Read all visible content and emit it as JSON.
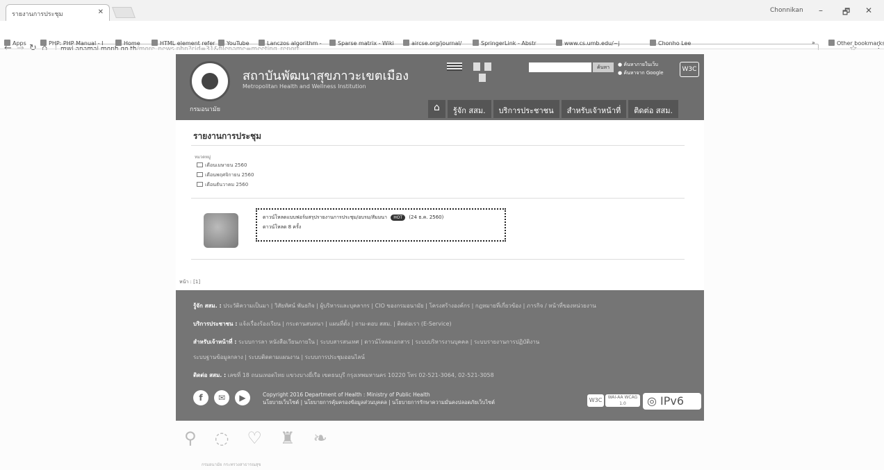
{
  "browser": {
    "tab_title": "รายงานการประชุม",
    "tab_close": "✕",
    "url_host": "mwi.anamai.moph.go.th",
    "url_path": "/more_news.php?cid=31&filename=meeting_report",
    "user_name": "Chonnikan",
    "win_min": "–",
    "win_max": "🗗",
    "win_close": "✕",
    "bookmarks": [
      "Apps",
      "PHP: PHP Manual - I",
      "Home",
      "HTML element refer",
      "YouTube",
      "Lanczos algorithm -",
      "Sparse matrix - Wiki",
      "aircse.org/journal/",
      "SpringerLink - Abstr",
      "www.cs.umb.edu/~j",
      "Chonho Lee"
    ],
    "other_bookmarks": "Other bookmarks",
    "more_bookmarks": "»"
  },
  "header": {
    "site_title": "สถาบันพัฒนาสุขภาวะเขตเมือง",
    "site_subtitle": "Metropolitan Health and Wellness Institution",
    "dept": "กรมอนามัย",
    "search_button": "ค้นหา",
    "radio1": "ค้นหาภายในเว็บ",
    "radio2": "ค้นหาจาก Google",
    "w3c": "W3C",
    "menu": [
      "รู้จัก สสม.",
      "บริการประชาชน",
      "สำหรับเจ้าหน้าที่",
      "ติดต่อ สสม."
    ]
  },
  "content": {
    "title": "รายงานการประชุม",
    "category_label": "หมวดหมู่",
    "folders": [
      "เดือนเมษายน 2560",
      "เดือนพฤศจิกายน 2560",
      "เดือนธันวาคม 2560"
    ],
    "doc_title": "ดาวน์โหลดแบบฟอร์มสรุปรายงานการประชุม/อบรม/สัมมนา",
    "hot_badge": "HOT",
    "doc_date": "(24 ธ.ค. 2560)",
    "doc_views": "ดาวน์โหลด 8 ครั้ง",
    "page_label": "หน้า : [1]"
  },
  "footer": {
    "rows": [
      {
        "label": "รู้จัก สสม. :",
        "links": "ประวัติความเป็นมา | วิสัยทัศน์ พันธกิจ | ผู้บริหารและบุคลากร | CIO ของกรมอนามัย | โครงสร้างองค์กร | กฎหมายที่เกี่ยวข้อง | ภารกิจ / หน้าที่ของหน่วยงาน"
      },
      {
        "label": "บริการประชาชน :",
        "links": "แจ้งเรื่องร้องเรียน | กระดานสนทนา | แผนที่ตั้ง | ถาม-ตอบ สสม. | ติดต่อเรา (E-Service)"
      },
      {
        "label": "สำหรับเจ้าหน้าที่ :",
        "links": "ระบบการลา หนังสือเวียนภายใน | ระบบสารสนเทศ | ดาวน์โหลดเอกสาร | ระบบบริหารงานบุคคล | ระบบรายงานการปฏิบัติงาน"
      },
      {
        "label": "",
        "links": "ระบบฐานข้อมูลกลาง | ระบบติดตามแผนงาน | ระบบการประชุมออนไลน์"
      },
      {
        "label": "ติดต่อ สสม. :",
        "links": "เลขที่ 18 ถนนเทอดไทย แขวงบางยี่เรือ เขตธนบุรี กรุงเทพมหานคร 10220 โทร 02-521-3064, 02-521-3058"
      }
    ],
    "copyright_line1": "Copyright 2016 Department of Health : Ministry of Public Health",
    "copyright_line2": "นโยบายเว็บไซต์ | นโยบายการคุ้มครองข้อมูลส่วนบุคคล | นโยบายการรักษาความมั่นคงปลอดภัยเว็บไซต์",
    "w3c_badge": "W3C",
    "wai_badge": "WAI-AA WCAG 1.0",
    "ipv6": "IPv6"
  },
  "bottom_text": "กรมอนามัย กระทรวงสาธารณสุข"
}
